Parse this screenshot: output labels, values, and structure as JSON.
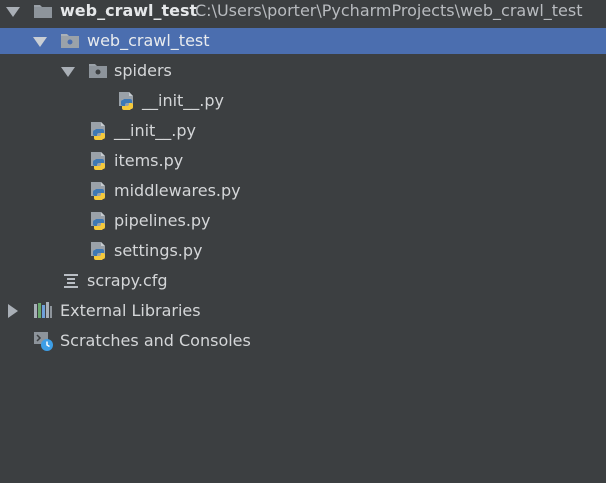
{
  "tree": {
    "root": {
      "name": "web_crawl_test",
      "path": "C:\\Users\\porter\\PycharmProjects\\web_crawl_test"
    },
    "package": {
      "name": "web_crawl_test"
    },
    "spiders_folder": {
      "name": "spiders"
    },
    "spiders_init": {
      "name": "__init__.py"
    },
    "files": [
      "__init__.py",
      "items.py",
      "middlewares.py",
      "pipelines.py",
      "settings.py"
    ],
    "config_file": {
      "name": "scrapy.cfg"
    },
    "external_libraries": {
      "name": "External Libraries"
    },
    "scratches": {
      "name": "Scratches and Consoles"
    }
  },
  "colors": {
    "background": "#3c3f41",
    "selection": "#4b6eaf",
    "text": "#d4d6d8",
    "folder": "#9aa1a8",
    "python_blue": "#3d78b5",
    "python_yellow": "#f5c93b"
  },
  "icons": {
    "root": "module-folder-icon",
    "package": "package-folder-icon",
    "spiders": "package-folder-icon",
    "python_file": "python-file-icon",
    "config_file": "config-file-icon",
    "external_libraries": "library-icon",
    "scratches": "scratches-icon"
  }
}
